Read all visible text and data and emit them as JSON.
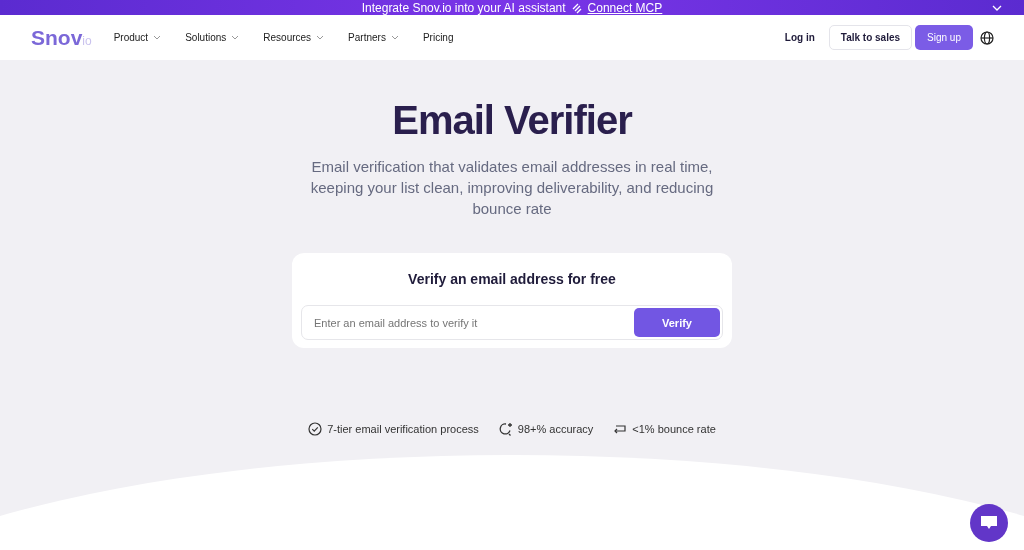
{
  "banner": {
    "text": "Integrate Snov.io into your AI assistant",
    "link": "Connect MCP"
  },
  "header": {
    "logo": {
      "name": "Snov",
      "suffix": "io"
    },
    "nav": [
      {
        "label": "Product",
        "dropdown": true
      },
      {
        "label": "Solutions",
        "dropdown": true
      },
      {
        "label": "Resources",
        "dropdown": true
      },
      {
        "label": "Partners",
        "dropdown": true
      },
      {
        "label": "Pricing",
        "dropdown": false
      }
    ],
    "login": "Log in",
    "sales": "Talk to sales",
    "signup": "Sign up"
  },
  "hero": {
    "title": "Email Verifier",
    "subtitle": "Email verification that validates email addresses in real time, keeping your list clean, improving deliverability, and reducing bounce rate"
  },
  "form": {
    "title": "Verify an email address for free",
    "placeholder": "Enter an email address to verify it",
    "button": "Verify"
  },
  "features": [
    {
      "kind": "check",
      "label": "7-tier email verification process"
    },
    {
      "kind": "accuracy",
      "label": "98+% accuracy"
    },
    {
      "kind": "bounce",
      "label": "<1% bounce rate"
    }
  ]
}
